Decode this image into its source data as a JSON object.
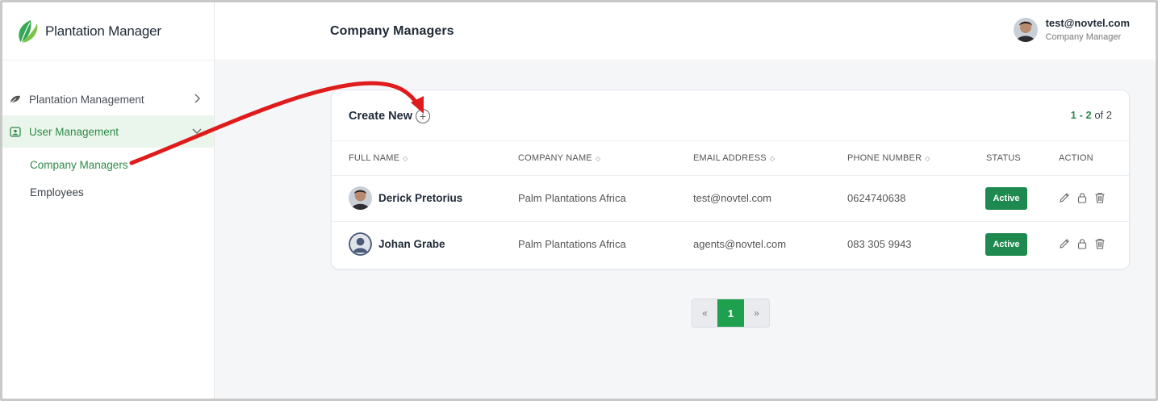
{
  "app": {
    "brand_name": "Plantation Manager",
    "accent_color": "#2e8a47",
    "badge_color": "#1e8a4f"
  },
  "sidebar": {
    "items": [
      {
        "label": "Plantation Management",
        "icon": "leaf-icon",
        "expanded": false
      },
      {
        "label": "User Management",
        "icon": "user-card-icon",
        "expanded": true,
        "children": [
          {
            "label": "Company Managers",
            "active": true
          },
          {
            "label": "Employees",
            "active": false
          }
        ]
      }
    ]
  },
  "header": {
    "title": "Company Managers",
    "user_email": "test@novtel.com",
    "user_role": "Company Manager"
  },
  "card": {
    "create_label": "Create New",
    "count_range": "1 - 2",
    "count_total": "of 2"
  },
  "table": {
    "columns": [
      "FULL NAME",
      "COMPANY NAME",
      "EMAIL ADDRESS",
      "PHONE NUMBER",
      "STATUS",
      "ACTION"
    ],
    "rows": [
      {
        "full_name": "Derick Pretorius",
        "company": "Palm Plantations Africa",
        "email": "test@novtel.com",
        "phone": "0624740638",
        "status": "Active",
        "avatar": "photo"
      },
      {
        "full_name": "Johan Grabe",
        "company": "Palm Plantations Africa",
        "email": "agents@novtel.com",
        "phone": "083 305 9943",
        "status": "Active",
        "avatar": "placeholder"
      }
    ]
  },
  "pagination": {
    "prev": "«",
    "current": "1",
    "next": "»"
  }
}
